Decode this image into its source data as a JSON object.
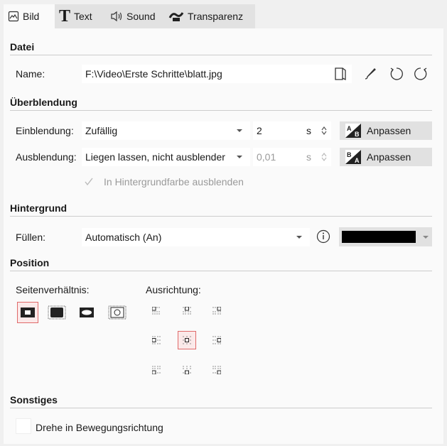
{
  "tabs": [
    {
      "label": "Bild",
      "icon": "image-icon",
      "active": true
    },
    {
      "label": "Text",
      "icon": "text-icon",
      "active": false
    },
    {
      "label": "Sound",
      "icon": "speaker-icon",
      "active": false
    },
    {
      "label": "Transparenz",
      "icon": "transparency-icon",
      "active": false
    }
  ],
  "datei": {
    "header": "Datei",
    "name_label": "Name:",
    "name_value": "F:\\Video\\Erste Schritte\\blatt.jpg"
  },
  "ueberblendung": {
    "header": "Überblendung",
    "ein_label": "Einblendung:",
    "ein_value": "Zufällig",
    "ein_duration": "2",
    "ein_unit": "s",
    "ein_button": "Anpassen",
    "aus_label": "Ausblendung:",
    "aus_value": "Liegen lassen, nicht ausblender",
    "aus_duration": "0,01",
    "aus_unit": "s",
    "aus_button": "Anpassen",
    "bg_checkbox_label": "In Hintergrundfarbe ausblenden"
  },
  "hintergrund": {
    "header": "Hintergrund",
    "fill_label": "Füllen:",
    "fill_value": "Automatisch (An)",
    "fill_color": "#000000"
  },
  "position": {
    "header": "Position",
    "aspect_label": "Seitenverhältnis:",
    "align_label": "Ausrichtung:"
  },
  "sonstiges": {
    "header": "Sonstiges",
    "rotate_label": "Drehe in Bewegungsrichtung"
  },
  "colors": {
    "accent": "#d9534f",
    "selected_border": "#e06a6a"
  }
}
